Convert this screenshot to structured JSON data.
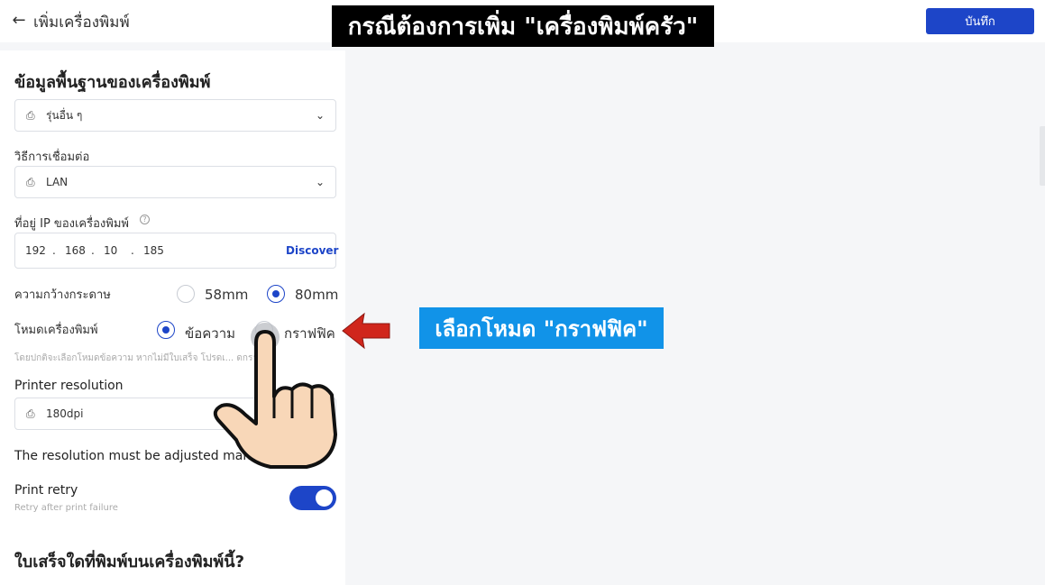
{
  "header": {
    "title": "เพิ่มเครื่องพิมพ์",
    "save_label": "บันทึก"
  },
  "overlay": {
    "banner_top": "กรณีต้องการเพิ่ม \"เครื่องพิมพ์ครัว\"",
    "annotation": "เลือกโหมด \"กราฟฟิค\""
  },
  "form": {
    "section_title": "ข้อมูลพื้นฐานของเครื่องพิมพ์",
    "model_value": "รุ่นอื่น ๆ",
    "connection_label": "วิธีการเชื่อมต่อ",
    "connection_value": "LAN",
    "ip_label": "ที่อยู่ IP ของเครื่องพิมพ์",
    "ip": [
      "192",
      "168",
      "10",
      "185"
    ],
    "discover_label": "Discover",
    "paper_label": "ความกว้างกระดาษ",
    "paper_options": [
      "58mm",
      "80mm"
    ],
    "paper_selected": "80mm",
    "mode_label": "โหมดเครื่องพิมพ์",
    "mode_options": [
      "ข้อความ",
      "กราฟฟิค"
    ],
    "mode_selected": "ข้อความ",
    "mode_hint": "โดยปกติจะเลือกโหมดข้อความ หากไม่มีใบเสร็จ โปรดเ... ดกราฟิก",
    "resolution_label": "Printer resolution",
    "resolution_value": "180dpi",
    "resolution_note": "The resolution must be adjusted manually.",
    "retry_label": "Print retry",
    "retry_hint": "Retry after print failure",
    "retry_on": true,
    "receipts_title": "ใบเสร็จใดที่พิมพ์บนเครื่องพิมพ์นี้?"
  },
  "colors": {
    "accent": "#1d45c8",
    "annotation_bg": "#1193e8",
    "arrow": "#d0261c"
  }
}
